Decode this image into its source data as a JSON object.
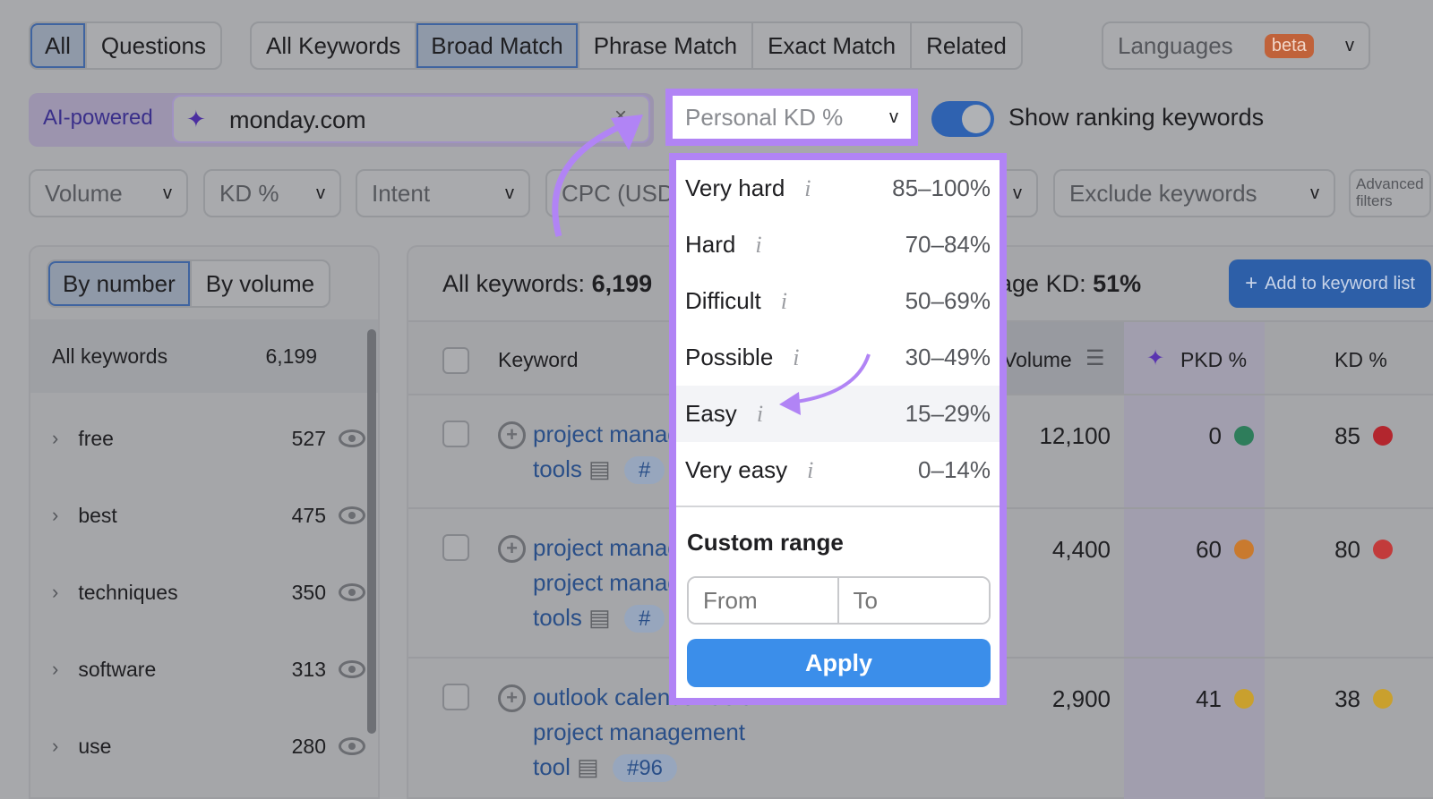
{
  "tabs1": [
    "All",
    "Questions"
  ],
  "tabs2": [
    "All Keywords",
    "Broad Match",
    "Phrase Match",
    "Exact Match",
    "Related"
  ],
  "languages": {
    "label": "Languages",
    "badge": "beta"
  },
  "search": {
    "ai_label": "AI-powered",
    "value": "monday.com"
  },
  "pkd_dropdown": "Personal KD %",
  "toggle_label": "Show ranking keywords",
  "filters": [
    "Volume",
    "KD %",
    "Intent",
    "CPC (USD)",
    "Exclude keywords",
    "Advanced filters"
  ],
  "sidebar": {
    "toggle": [
      "By number",
      "By volume"
    ],
    "all": {
      "label": "All keywords",
      "count": "6,199"
    },
    "groups": [
      {
        "label": "free",
        "count": "527"
      },
      {
        "label": "best",
        "count": "475"
      },
      {
        "label": "techniques",
        "count": "350"
      },
      {
        "label": "software",
        "count": "313"
      },
      {
        "label": "use",
        "count": "280"
      }
    ]
  },
  "summary": {
    "all_label": "All keywords:",
    "all_value": "6,199",
    "avg_label": "Average KD:",
    "avg_value": "51%",
    "add_button": "Add to keyword list"
  },
  "table": {
    "headers": {
      "keyword": "Keyword",
      "volume": "Volume",
      "pkd": "PKD %",
      "kd": "KD %"
    },
    "rows": [
      {
        "keyword_lines": [
          "project management",
          "tools"
        ],
        "badge": "#",
        "volume": "12,100",
        "pkd": "0",
        "pkd_color": "#2e7d5b",
        "kd": "85",
        "kd_color": "#b3262e"
      },
      {
        "keyword_lines": [
          "project management",
          "project management",
          "tools"
        ],
        "badge": "#",
        "volume": "4,400",
        "pkd": "60",
        "pkd_color": "#c97a2e",
        "kd": "80",
        "kd_color": "#c23b3b"
      },
      {
        "keyword_lines": [
          "outlook calendar as a",
          "project management",
          "tool"
        ],
        "badge": "#96",
        "volume": "2,900",
        "pkd": "41",
        "pkd_color": "#c9a02e",
        "kd": "38",
        "kd_color": "#c9a02e"
      }
    ]
  },
  "menu": {
    "items": [
      {
        "label": "Very hard",
        "range": "85–100%"
      },
      {
        "label": "Hard",
        "range": "70–84%"
      },
      {
        "label": "Difficult",
        "range": "50–69%"
      },
      {
        "label": "Possible",
        "range": "30–49%"
      },
      {
        "label": "Easy",
        "range": "15–29%"
      },
      {
        "label": "Very easy",
        "range": "0–14%"
      }
    ],
    "custom_title": "Custom range",
    "from_placeholder": "From",
    "to_placeholder": "To",
    "apply": "Apply"
  },
  "colors": {
    "highlight": "#b184f5",
    "primary": "#3b8eea",
    "badge": "#e0612f"
  }
}
